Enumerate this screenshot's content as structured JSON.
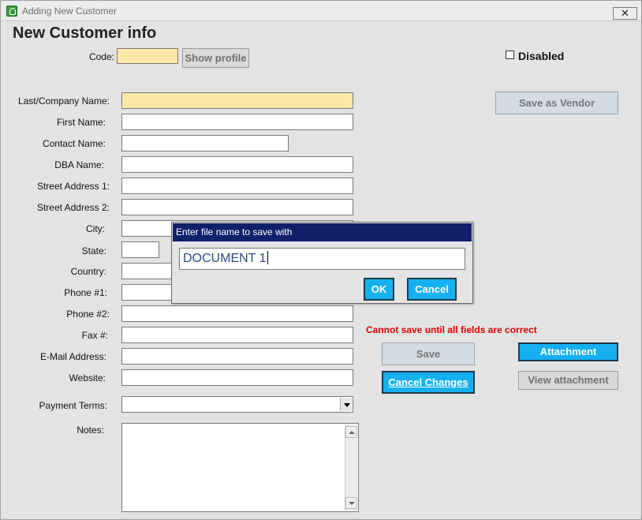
{
  "window": {
    "title": "Adding New Customer",
    "close_label": "✕"
  },
  "heading": "New Customer info",
  "code": {
    "label": "Code:",
    "value": ""
  },
  "show_profile_label": "Show profile",
  "disabled": {
    "label": "Disabled",
    "checked": false
  },
  "save_as_vendor_label": "Save as Vendor",
  "fields": [
    {
      "label": "Last/Company Name:",
      "value": ""
    },
    {
      "label": "First Name:",
      "value": ""
    },
    {
      "label": "Contact Name:",
      "value": ""
    },
    {
      "label": "DBA Name:",
      "value": ""
    },
    {
      "label": "Street Address 1:",
      "value": ""
    },
    {
      "label": "Street Address 2:",
      "value": ""
    },
    {
      "label": "City:",
      "value": ""
    },
    {
      "label": "State:",
      "value": ""
    },
    {
      "label": "Country:",
      "value": ""
    },
    {
      "label": "Phone #1:",
      "value": ""
    },
    {
      "label": "Phone #2:",
      "value": ""
    },
    {
      "label": "Fax #:",
      "value": ""
    },
    {
      "label": "E-Mail Address:",
      "value": ""
    },
    {
      "label": "Website:",
      "value": ""
    }
  ],
  "payment_terms": {
    "label": "Payment Terms:",
    "value": ""
  },
  "notes": {
    "label": "Notes:",
    "value": ""
  },
  "error_message": "Cannot save until all fields are correct",
  "buttons": {
    "save": "Save",
    "cancel_changes": "Cancel Changes",
    "attachment": "Attachment",
    "view_attachment": "View attachment"
  },
  "dialog": {
    "title": "Enter file name to save with",
    "input_value": "DOCUMENT 1",
    "ok_label": "OK",
    "cancel_label": "Cancel"
  },
  "colors": {
    "required_field": "#fde8a8",
    "accent_button": "#16b0f0",
    "dialog_title_bar": "#10206a",
    "error_text": "#e00000"
  }
}
